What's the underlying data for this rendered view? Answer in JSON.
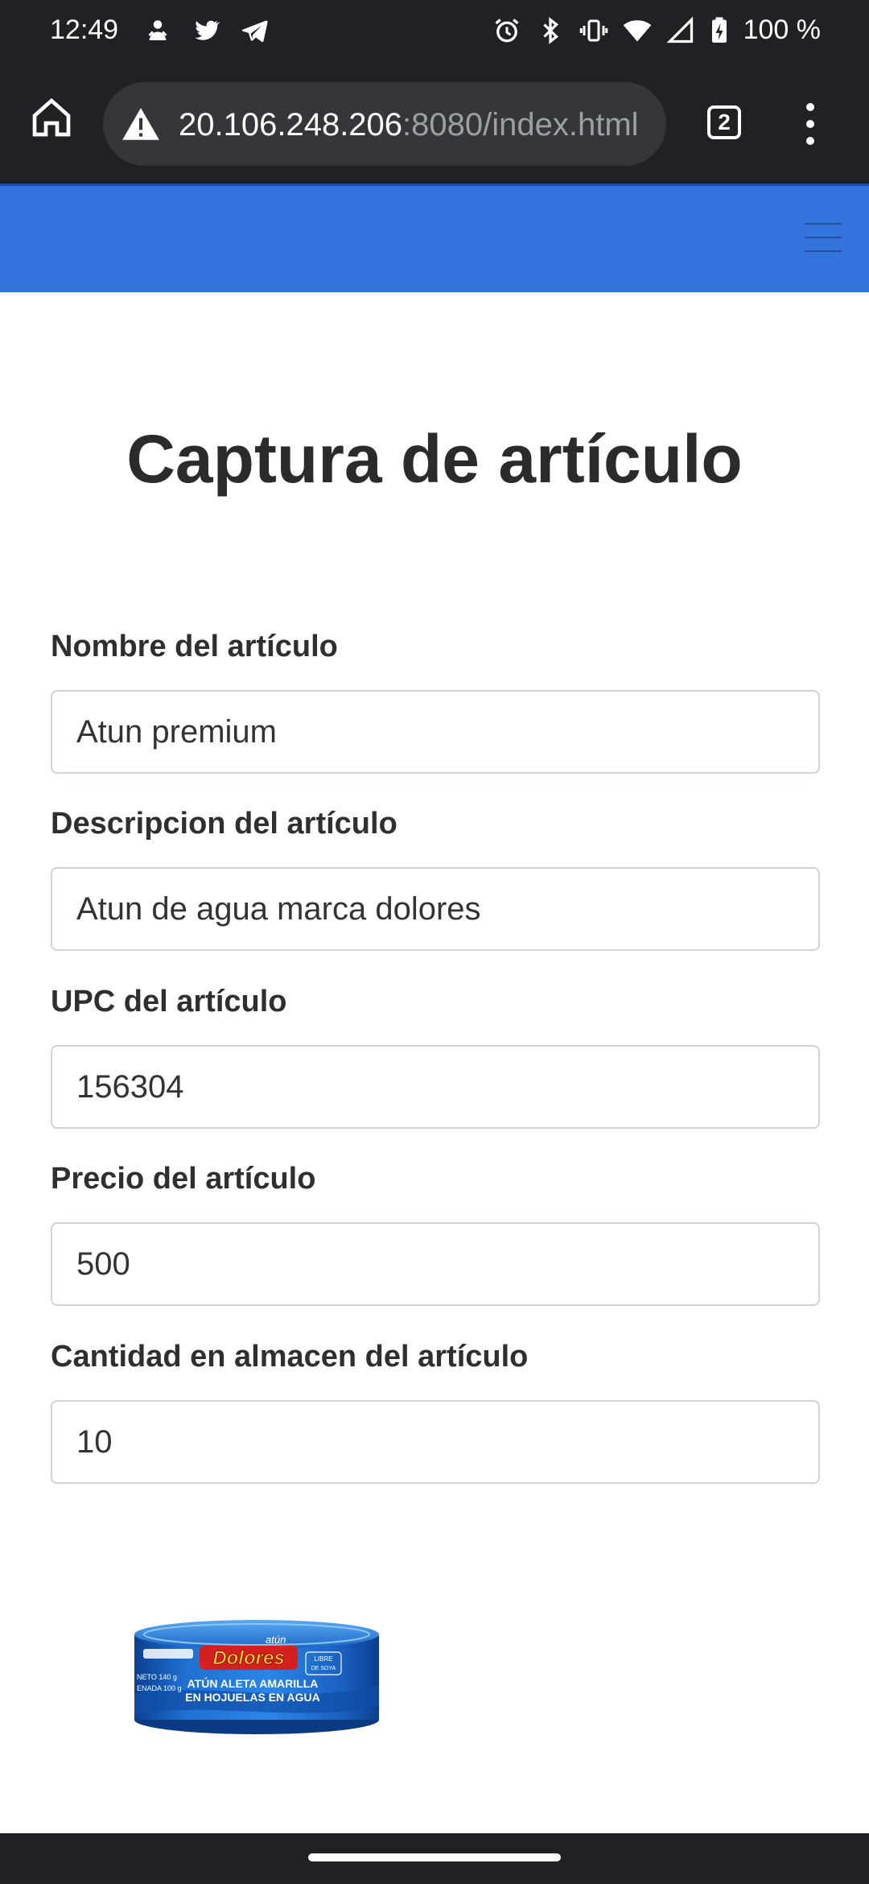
{
  "status": {
    "time": "12:49",
    "battery": "100 %"
  },
  "browser": {
    "url_host": "20.106.248.206",
    "url_rest": ":8080/index.html",
    "tab_count": "2"
  },
  "page": {
    "title": "Captura de artículo"
  },
  "form": {
    "fields": [
      {
        "label": "Nombre del artículo",
        "value": "Atun premium"
      },
      {
        "label": "Descripcion del artículo",
        "value": "Atun de agua marca dolores"
      },
      {
        "label": "UPC del artículo",
        "value": "156304"
      },
      {
        "label": "Precio del artículo",
        "value": "500"
      },
      {
        "label": "Cantidad en almacen del artículo",
        "value": "10"
      }
    ]
  },
  "product_image": {
    "brand_sub": "atún",
    "brand": "Dolores",
    "line1": "ATÚN ALETA AMARILLA",
    "line2": "EN HOJUELAS EN AGUA",
    "side_left1": "NETO 140 g",
    "side_left2": "ENADA 100 g",
    "side_badge1": "LIBRE",
    "side_badge2": "DE SOYA"
  },
  "colors": {
    "navbar": "#3373dc",
    "system_bar": "#202124"
  }
}
